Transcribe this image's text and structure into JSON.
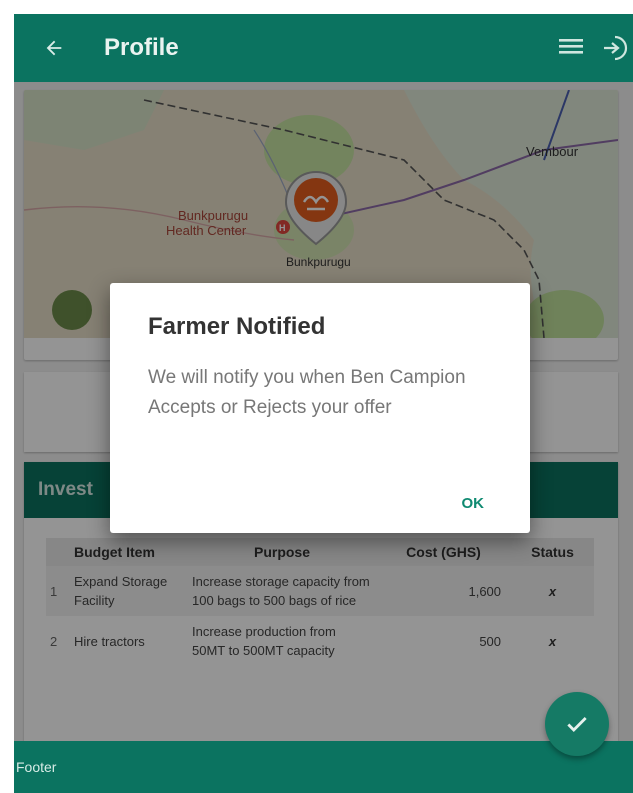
{
  "appbar": {
    "title": "Profile",
    "icons": {
      "back": "arrow-left-icon",
      "menu": "hamburger-menu-icon",
      "logout": "logout-icon"
    }
  },
  "map": {
    "labels": {
      "place1": "Vembour",
      "place2_line1": "Bunkpurugu",
      "place2_line2": "Health Center",
      "place3": "Bunkpurugu"
    },
    "icons": {
      "marker": "farm-location-pin-icon",
      "hospital": "hospital-marker-icon"
    }
  },
  "investment": {
    "header": "Invest",
    "columns": [
      "",
      "Budget Item",
      "Purpose",
      "Cost (GHS)",
      "Status"
    ],
    "rows": [
      {
        "num": "1",
        "item": "Expand Storage Facility",
        "purpose": "Increase storage capacity from 100 bags to 500 bags of rice",
        "cost": "1,600",
        "status": "x"
      },
      {
        "num": "2",
        "item": "Hire tractors",
        "purpose": "Increase production from 50MT to 500MT capacity",
        "cost": "500",
        "status": "x"
      }
    ]
  },
  "dialog": {
    "title": "Farmer Notified",
    "body": "We will notify you when Ben Campion Accepts or Rejects your offer",
    "ok_label": "OK"
  },
  "footer": {
    "label": "Footer"
  },
  "fab": {
    "icon": "checkmark-icon"
  },
  "colors": {
    "primary": "#0b7360",
    "accent": "#0f8a71",
    "scrim": "rgba(0,0,0,0.42)"
  }
}
